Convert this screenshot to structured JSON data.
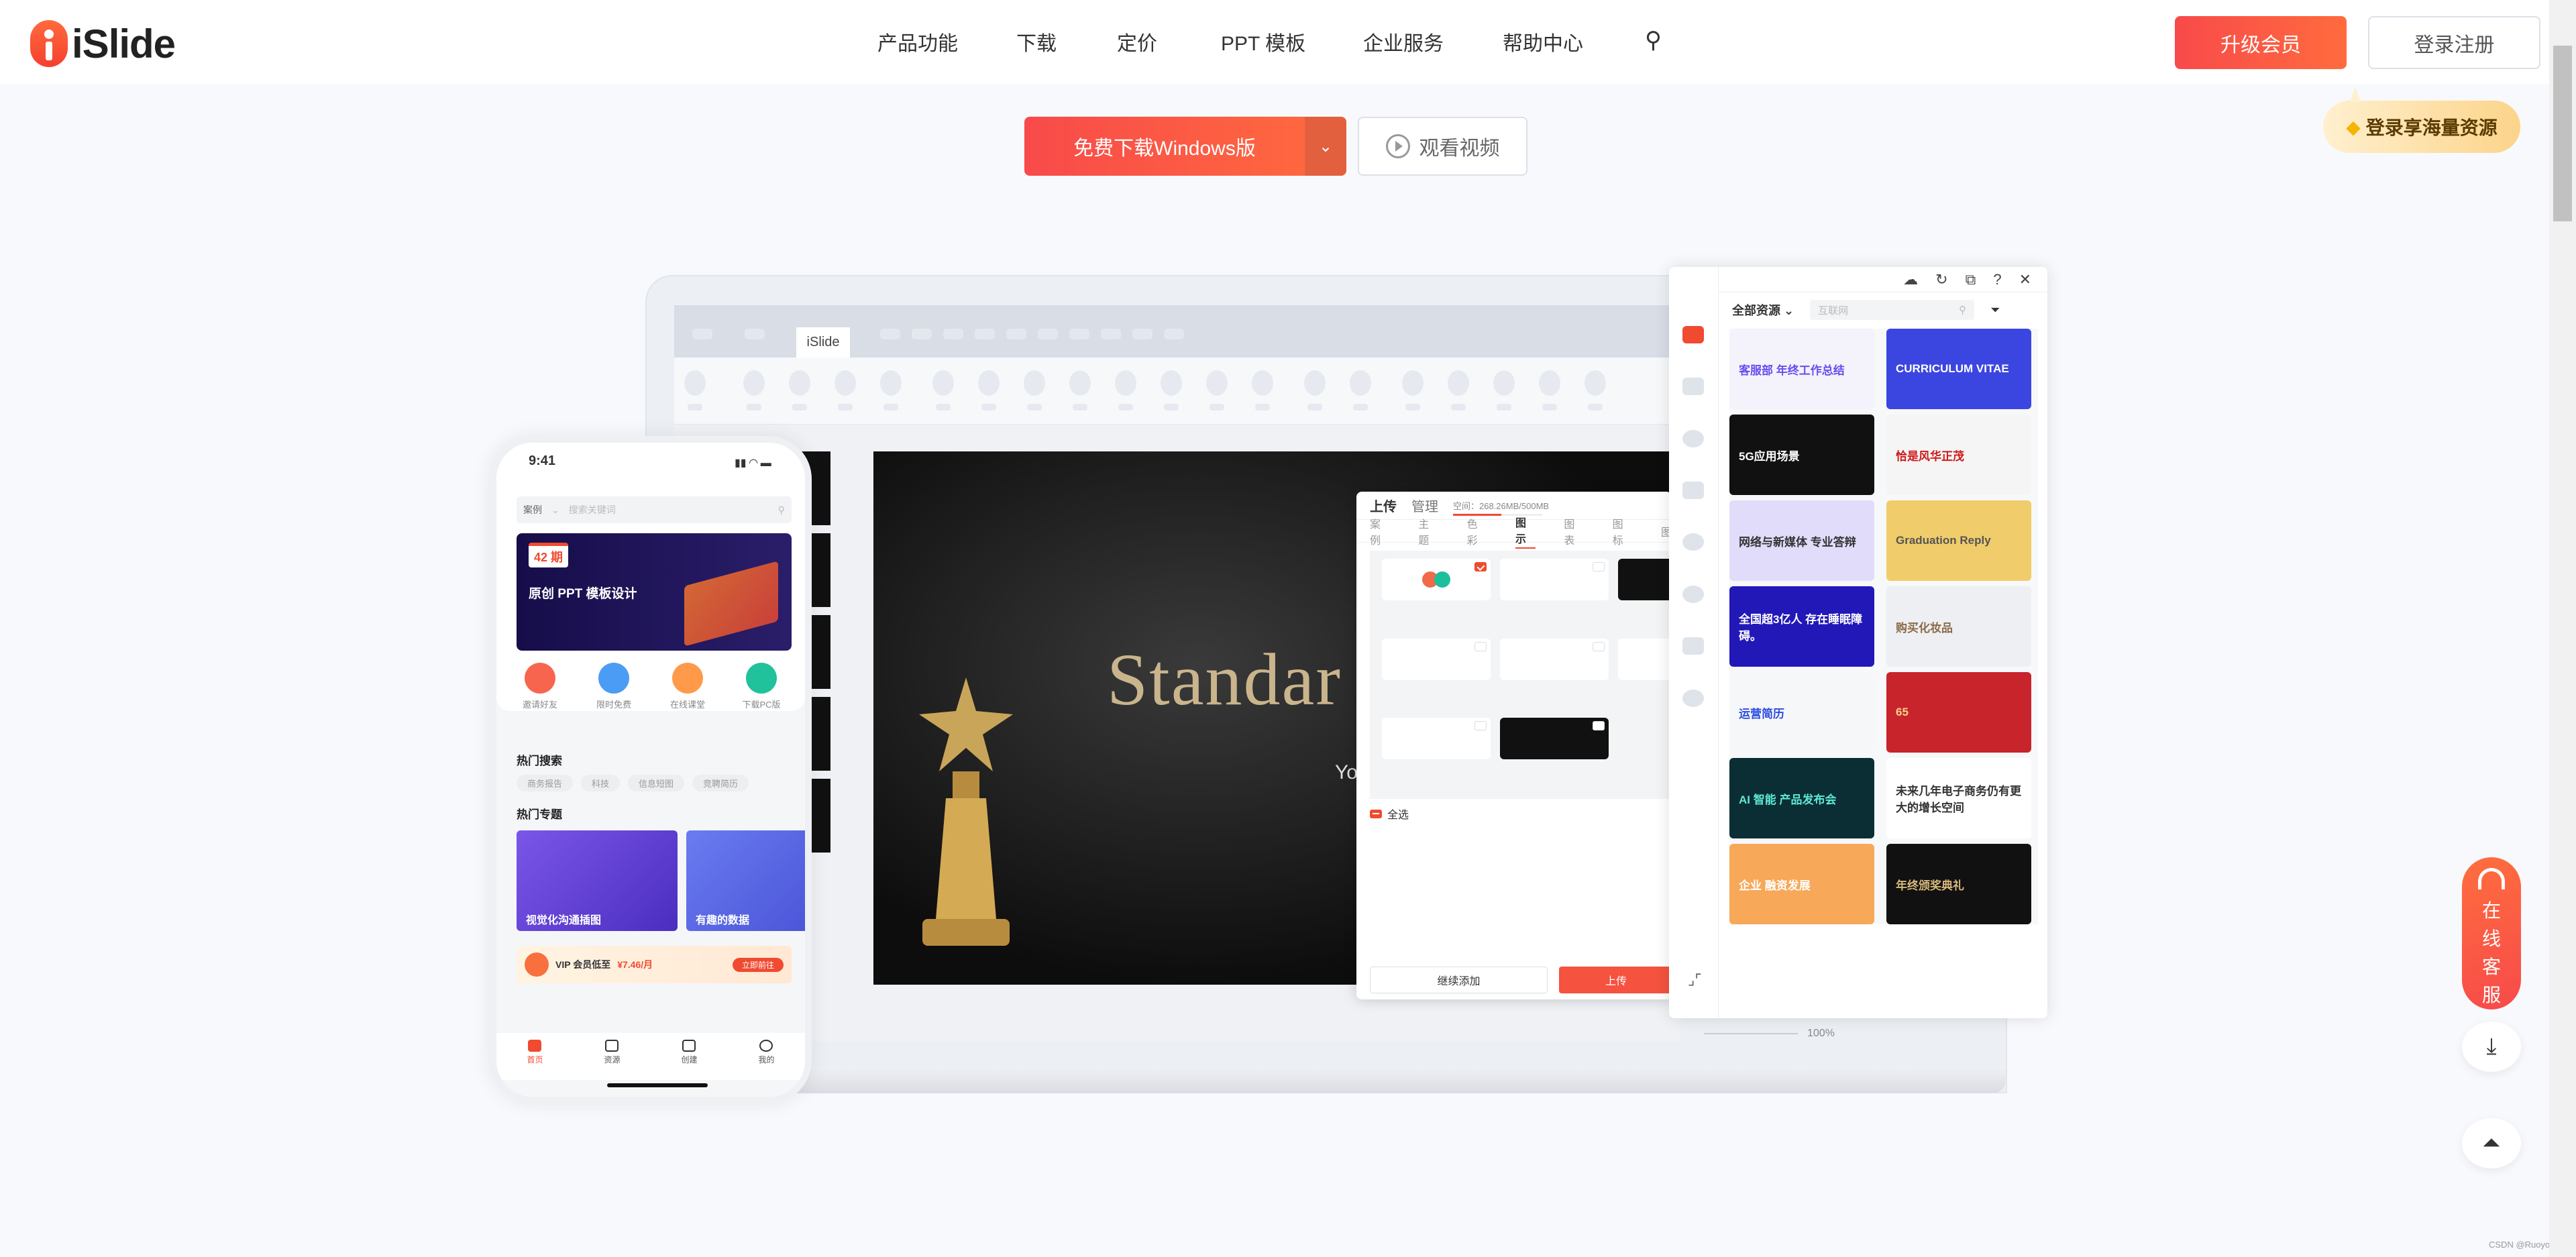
{
  "header": {
    "logo": "iSlide",
    "nav": [
      "产品功能",
      "下载",
      "定价",
      "PPT 模板",
      "企业服务",
      "帮助中心"
    ],
    "upgrade": "升级会员",
    "login": "登录注册",
    "tooltip": "登录享海量资源"
  },
  "hero": {
    "download": "免费下载Windows版",
    "video": "观看视频"
  },
  "app": {
    "tab": "iSlide",
    "slide_title": "Standar",
    "slide_sub": "You",
    "zoom": "100%"
  },
  "phone": {
    "time": "9:41",
    "search_cat": "案例",
    "search_placeholder": "搜索关键词",
    "issue": "42 期",
    "banner_title": "原创 PPT 模板设计",
    "icons": [
      {
        "label": "邀请好友",
        "color": "#f8654e"
      },
      {
        "label": "限时免费",
        "color": "#4a9cf5"
      },
      {
        "label": "在线课堂",
        "color": "#ff9a4a"
      },
      {
        "label": "下载PC版",
        "color": "#1fc29a"
      }
    ],
    "hot_search": "热门搜索",
    "tags": [
      "商务报告",
      "科技",
      "信息短图",
      "竞聘简历"
    ],
    "hot_topic": "热门专题",
    "cards": [
      "视觉化沟通插图",
      "有趣的数据"
    ],
    "vip": "VIP 会员低至",
    "vip_price": "¥7.46/月",
    "vip_go": "立即前往",
    "tabs": [
      "首页",
      "资源",
      "创建",
      "我的"
    ]
  },
  "upload": {
    "tab_upload": "上传",
    "tab_manage": "管理",
    "space": "空间：268.26MB/500MB",
    "space_used": 0.54,
    "categories": [
      "案例",
      "主题",
      "色彩",
      "图示",
      "图表",
      "图标",
      "图"
    ],
    "active_category": "图示",
    "select_all": "全选",
    "continue": "继续添加",
    "submit": "上传"
  },
  "resources": {
    "filter": "全部资源",
    "search_placeholder": "互联网",
    "templates": [
      {
        "title": "客服部 年终工作总结",
        "bg": "#f4f3fb",
        "fg": "#6a4cf0"
      },
      {
        "title": "CURRICULUM VITAE",
        "bg": "#3b46e0",
        "fg": "#ffffff"
      },
      {
        "title": "5G应用场景",
        "bg": "#111111",
        "fg": "#ffffff"
      },
      {
        "title": "恰是风华正茂",
        "bg": "#f5f5f5",
        "fg": "#d01818"
      },
      {
        "title": "网络与新媒体 专业答辩",
        "bg": "#e2dcfb",
        "fg": "#333333"
      },
      {
        "title": "Graduation Reply",
        "bg": "#f0cc6a",
        "fg": "#555555"
      },
      {
        "title": "全国超3亿人 存在睡眠障碍。",
        "bg": "#2218b8",
        "fg": "#ffffff"
      },
      {
        "title": "购买化妆品",
        "bg": "#eeeff2",
        "fg": "#8a6a48"
      },
      {
        "title": "运营简历",
        "bg": "#f6f7f9",
        "fg": "#2b4ce0"
      },
      {
        "title": "65",
        "bg": "#c8242c",
        "fg": "#f6d38a"
      },
      {
        "title": "AI 智能 产品发布会",
        "bg": "#0b2e34",
        "fg": "#5ee8d8"
      },
      {
        "title": "未来几年电子商务仍有更大的增长空间",
        "bg": "#ffffff",
        "fg": "#333333"
      },
      {
        "title": "企业 融资发展",
        "bg": "#f7a858",
        "fg": "#ffffff"
      },
      {
        "title": "年终颁奖典礼",
        "bg": "#111111",
        "fg": "#d7b77a"
      }
    ]
  },
  "float": {
    "service": [
      "在",
      "线",
      "客",
      "服"
    ]
  },
  "watermark": "CSDN @Ruoyo176"
}
